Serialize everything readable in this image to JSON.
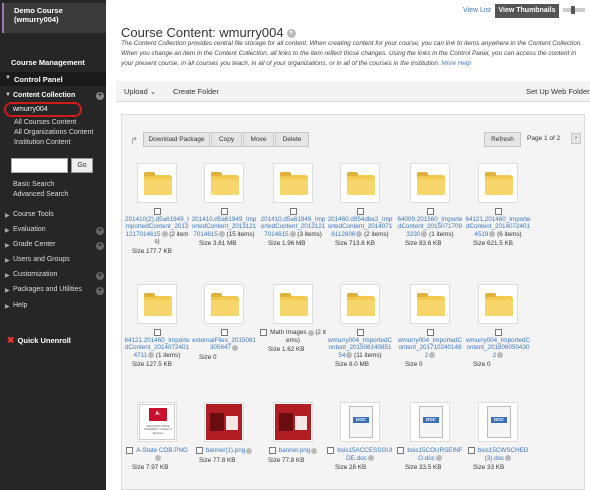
{
  "sidebar": {
    "course_line1": "Demo Course",
    "course_line2": "(wmurry004)",
    "course_management": "Course Management",
    "control_panel": "Control Panel",
    "content_collection": "Content Collection",
    "current_item": "wmurry004",
    "sub_links": [
      "All Courses Content",
      "All Organizations Content",
      "Institution Content"
    ],
    "go_label": "Go",
    "basic_search": "Basic Search",
    "advanced_search": "Advanced Search",
    "tools": [
      "Course Tools",
      "Evaluation",
      "Grade Center",
      "Users and Groups",
      "Customization",
      "Packages and Utilities",
      "Help"
    ],
    "quick_unenroll": "Quick Unenroll"
  },
  "header": {
    "title": "Course Content: wmurry004",
    "view_list": "View List",
    "view_thumbnails": "View Thumbnails",
    "description": "The Content Collection provides central file storage for all content. When creating content for your course, you can link to items anywhere in the Content Collection. When you change an item in the Content Collection, all links to the item reflect those changes. Using the links in the Control Panel, you can access the content in your present course, in all courses you teach, in all of your organizations, or in all of the courses in the institution.",
    "more_help": "More Help"
  },
  "actions": {
    "upload": "Upload",
    "create_folder": "Create Folder",
    "web_folder": "Set Up Web Folder",
    "download_package": "Download Package",
    "copy": "Copy",
    "move": "Move",
    "delete": "Delete",
    "refresh": "Refresh",
    "page": "Page 1 of 2"
  },
  "items": [
    {
      "name": "201410(2).d5a61949_ImportedContent_20131217014615",
      "count": "(2 items)",
      "size": "Size 177.7 KB",
      "type": "folder"
    },
    {
      "name": "201410.d5a61949_ImportedContent_20131217014615",
      "count": "(15 items)",
      "size": "Size 3.61 MB",
      "type": "folder"
    },
    {
      "name": "201410.d5a61949_ImportedContent_20131217014615",
      "count": "(3 items)",
      "size": "Size 1.96 MB",
      "type": "folder"
    },
    {
      "name": "201460.d954dbe2_ImportedContent_20140716112606",
      "count": "(2 items)",
      "size": "Size 713.8 KB",
      "type": "folder"
    },
    {
      "name": "64009.201560_ImportedContent_20150717093230",
      "count": "(1 items)",
      "size": "Size 83.6 KB",
      "type": "folder"
    },
    {
      "name": "64121.201460_ImportedContent_20140724014519",
      "count": "(6 items)",
      "size": "Size 621.5 KB",
      "type": "folder"
    },
    {
      "name": "64121.201460_ImportedContent_20140724014711",
      "count": "(1 items)",
      "size": "Size 127.5 KB",
      "type": "folder"
    },
    {
      "name": "externalFiles_2015081305647",
      "count": "",
      "size": "Size 0",
      "type": "folder"
    },
    {
      "name": "Math Images",
      "count": "(2 items)",
      "size": "Size 1.62 KB",
      "type": "folder"
    },
    {
      "name": "wmurry004_ImportedContent_20150814085154",
      "count": "(11 items)",
      "size": "Size 8.0 MB",
      "type": "folder"
    },
    {
      "name": "wmurry004_ImportedContent_2017102401482",
      "count": "",
      "size": "Size 0",
      "type": "folder"
    },
    {
      "name": "wmurry004_ImportedContent_2018060504302",
      "count": "",
      "size": "Size 0",
      "type": "folder"
    },
    {
      "name": "A-State COB.PNG",
      "count": "",
      "size": "Size 7.97 KB",
      "type": "logo"
    },
    {
      "name": "banner(1).png",
      "count": "",
      "size": "Size 77.8 KB",
      "type": "banner"
    },
    {
      "name": "banner.png",
      "count": "",
      "size": "Size 77.8 KB",
      "type": "banner"
    },
    {
      "name": "bsis15ACCESSGUIDE.doc",
      "count": "",
      "size": "Size 28 KB",
      "type": "doc"
    },
    {
      "name": "bsis15COURSEINFO.doc",
      "count": "",
      "size": "Size 33.5 KB",
      "type": "doc"
    },
    {
      "name": "bsis15CWSCHED(3).doc",
      "count": "",
      "size": "Size 33 KB",
      "type": "doc"
    }
  ],
  "logo_text": {
    "mark": "A-STATE",
    "caption": "ARKANSAS STATE UNIVERSITY College of Business"
  },
  "doc_tag": "DOC",
  "colors": {
    "sidebar": "#262626",
    "link": "#3a78c3",
    "highlight_ring": "#d31a1a",
    "folder": "#f2c94c"
  }
}
